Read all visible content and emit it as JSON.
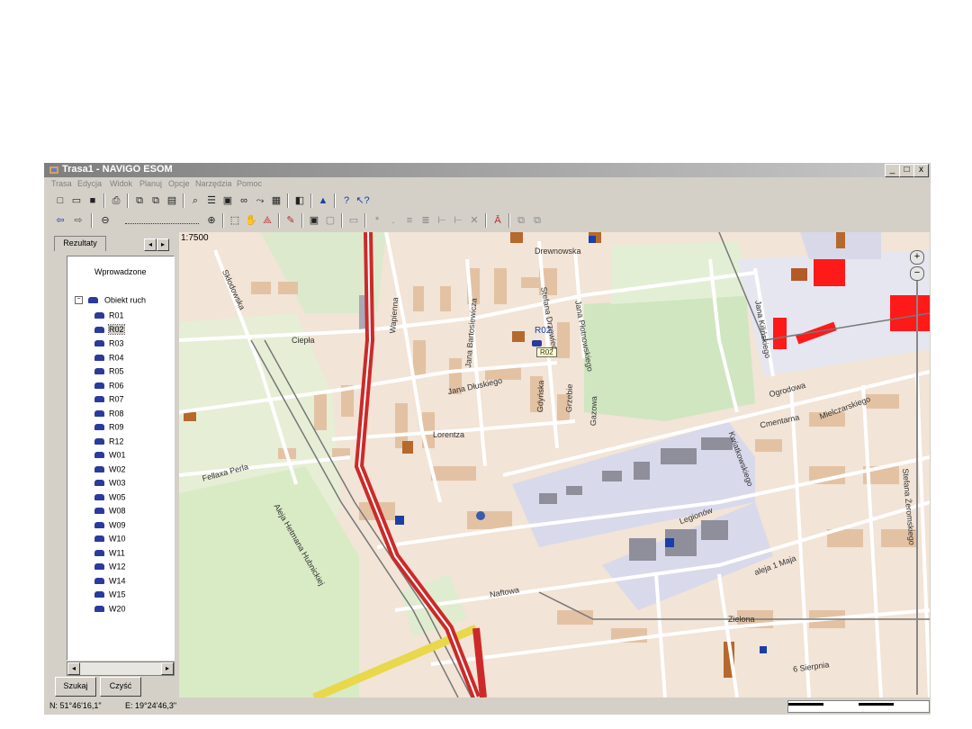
{
  "window": {
    "title": "Trasa1 - NAVIGO ESOM",
    "minimize": "_",
    "maximize": "□",
    "close": "x"
  },
  "menu": [
    "Trasa",
    "Edycja",
    "Widok",
    "Planuj",
    "Opcje",
    "Narzędzia",
    "Pomoc"
  ],
  "toolbar1": [
    "new-icon",
    "open-icon",
    "save-icon",
    "print-icon",
    "copy-icon",
    "paste-icon",
    "cut-icon",
    "find-icon",
    "list-icon",
    "layers-icon",
    "binoculars-icon",
    "route-icon",
    "grid-icon",
    "screen-icon",
    "navigo-icon",
    "help-icon",
    "context-help-icon"
  ],
  "toolbar2": [
    "back-icon",
    "forward-icon",
    "zoom-out-icon",
    "zoom-slider",
    "zoom-in-icon",
    "select-icon",
    "hand-icon",
    "measure-icon",
    "draw-icon",
    "frame-icon",
    "copy-map-icon",
    "message-icon",
    "point-icon",
    "dot-icon",
    "align-icon",
    "align2-icon",
    "tree-icon",
    "tree2-icon",
    "delete-icon",
    "text-icon",
    "export-icon",
    "import-icon"
  ],
  "left_panel": {
    "tab": "Rezultaty",
    "tree_header": "Wprowadzone",
    "group": "Obiekt ruch",
    "items": [
      "R01",
      "R02",
      "R03",
      "R04",
      "R05",
      "R06",
      "R07",
      "R08",
      "R09",
      "R12",
      "W01",
      "W02",
      "W03",
      "W05",
      "W08",
      "W09",
      "W10",
      "W11",
      "W12",
      "W14",
      "W15",
      "W20"
    ],
    "selected": "R02",
    "search_button": "Szukaj",
    "clear_button": "Czyść"
  },
  "map": {
    "scale": "1:7500",
    "vehicle_label": "R02",
    "vehicle_tooltip": "R02",
    "streets": [
      "Drewnowska",
      "Ciepła",
      "Wapienna",
      "Jana Bartosiewicza",
      "Stefana Drzewiec",
      "Jana Dłuskiego",
      "Jana Płotnowskiego",
      "Jana Kilińskiego",
      "Ogrodowa",
      "Lorentza",
      "Gdyńska",
      "Grzebie",
      "Gazowa",
      "Cmentarna",
      "Mielczarskiego",
      "Legionów",
      "Kwiatkowskiego",
      "Fellaxa Perla",
      "Aleja Hetmana Hubnickiej",
      "aleja 1 Maja",
      "Naftowa",
      "Zielona",
      "6 Sierpnia",
      "Stefana Żeromskiego",
      "Skłodowska"
    ]
  },
  "status": {
    "north": "N: 51°46'16,1\"",
    "east": "E: 19°24'46,3\""
  },
  "colors": {
    "road_main": "#cc2a2a",
    "road_yellow": "#f0e15a",
    "park": "#d8ecc4",
    "industrial": "#d8d8ea",
    "building": "#dcb294",
    "highlight": "#ff1a1a",
    "water": "#e8f2f8"
  }
}
